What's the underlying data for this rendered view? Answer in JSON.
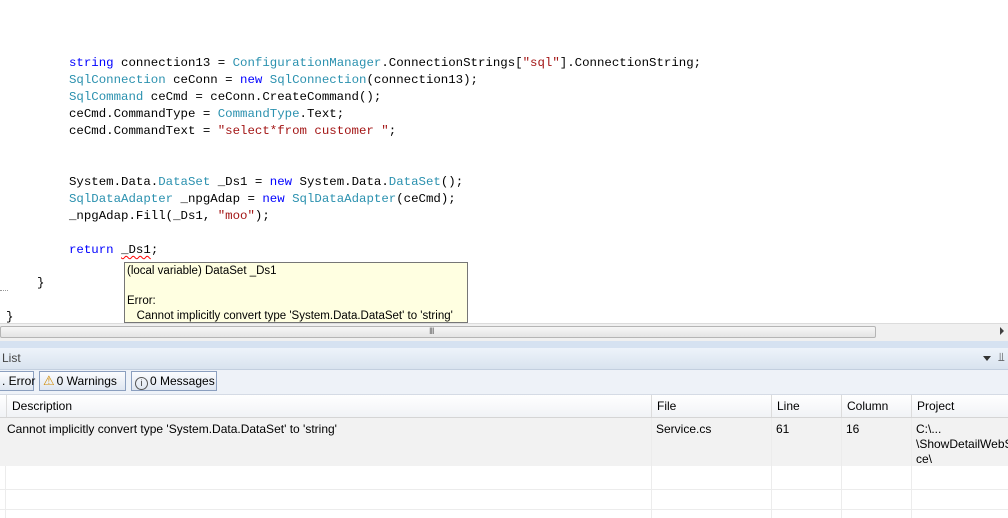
{
  "editor": {
    "lines": [
      [
        {
          "t": "string",
          "c": "kw"
        },
        {
          "t": " connection13 = "
        },
        {
          "t": "ConfigurationManager",
          "c": "ty"
        },
        {
          "t": ".ConnectionStrings["
        },
        {
          "t": "\"sql\"",
          "c": "st"
        },
        {
          "t": "].ConnectionString;"
        }
      ],
      [
        {
          "t": "SqlConnection",
          "c": "ty"
        },
        {
          "t": " ceConn = "
        },
        {
          "t": "new",
          "c": "kw"
        },
        {
          "t": " "
        },
        {
          "t": "SqlConnection",
          "c": "ty"
        },
        {
          "t": "(connection13);"
        }
      ],
      [
        {
          "t": "SqlCommand",
          "c": "ty"
        },
        {
          "t": " ceCmd = ceConn.CreateCommand();"
        }
      ],
      [
        {
          "t": "ceCmd.CommandType = "
        },
        {
          "t": "CommandType",
          "c": "ty"
        },
        {
          "t": ".Text;"
        }
      ],
      [
        {
          "t": "ceCmd.CommandText = "
        },
        {
          "t": "\"select*from customer \"",
          "c": "st"
        },
        {
          "t": ";"
        }
      ],
      [],
      [],
      [
        {
          "t": "System.Data."
        },
        {
          "t": "DataSet",
          "c": "ty"
        },
        {
          "t": " _Ds1 = "
        },
        {
          "t": "new",
          "c": "kw"
        },
        {
          "t": " System.Data."
        },
        {
          "t": "DataSet",
          "c": "ty"
        },
        {
          "t": "();"
        }
      ],
      [
        {
          "t": "SqlDataAdapter",
          "c": "ty"
        },
        {
          "t": " _npgAdap = "
        },
        {
          "t": "new",
          "c": "kw"
        },
        {
          "t": " "
        },
        {
          "t": "SqlDataAdapter",
          "c": "ty"
        },
        {
          "t": "(ceCmd);"
        }
      ],
      [
        {
          "t": "_npgAdap.Fill(_Ds1, "
        },
        {
          "t": "\"moo\"",
          "c": "st"
        },
        {
          "t": ");"
        }
      ],
      [],
      [
        {
          "t": "return",
          "c": "kw"
        },
        {
          "t": " "
        },
        {
          "t": "_Ds1",
          "c": "squig"
        },
        {
          "t": ";"
        }
      ]
    ],
    "close_brace_inner": "}",
    "close_brace_outer": "}"
  },
  "tooltip": {
    "line1": "(local variable) DataSet _Ds1",
    "line2": "",
    "line3": "Error:",
    "line4": "   Cannot implicitly convert type 'System.Data.DataSet' to 'string'"
  },
  "scrollbar": {
    "grip": "III"
  },
  "error_list": {
    "title": "List",
    "pin": "⫫",
    "filters": {
      "errors": ". Error",
      "warnings": "0 Warnings",
      "messages": "0 Messages"
    },
    "columns": [
      "Description",
      "File",
      "Line",
      "Column",
      "Project"
    ],
    "rows": [
      {
        "description": "Cannot implicitly convert type 'System.Data.DataSet' to 'string'",
        "file": "Service.cs",
        "line": "61",
        "column": "16",
        "project": "C:\\...\n\\ShowDetailWebS\nce\\"
      }
    ]
  }
}
